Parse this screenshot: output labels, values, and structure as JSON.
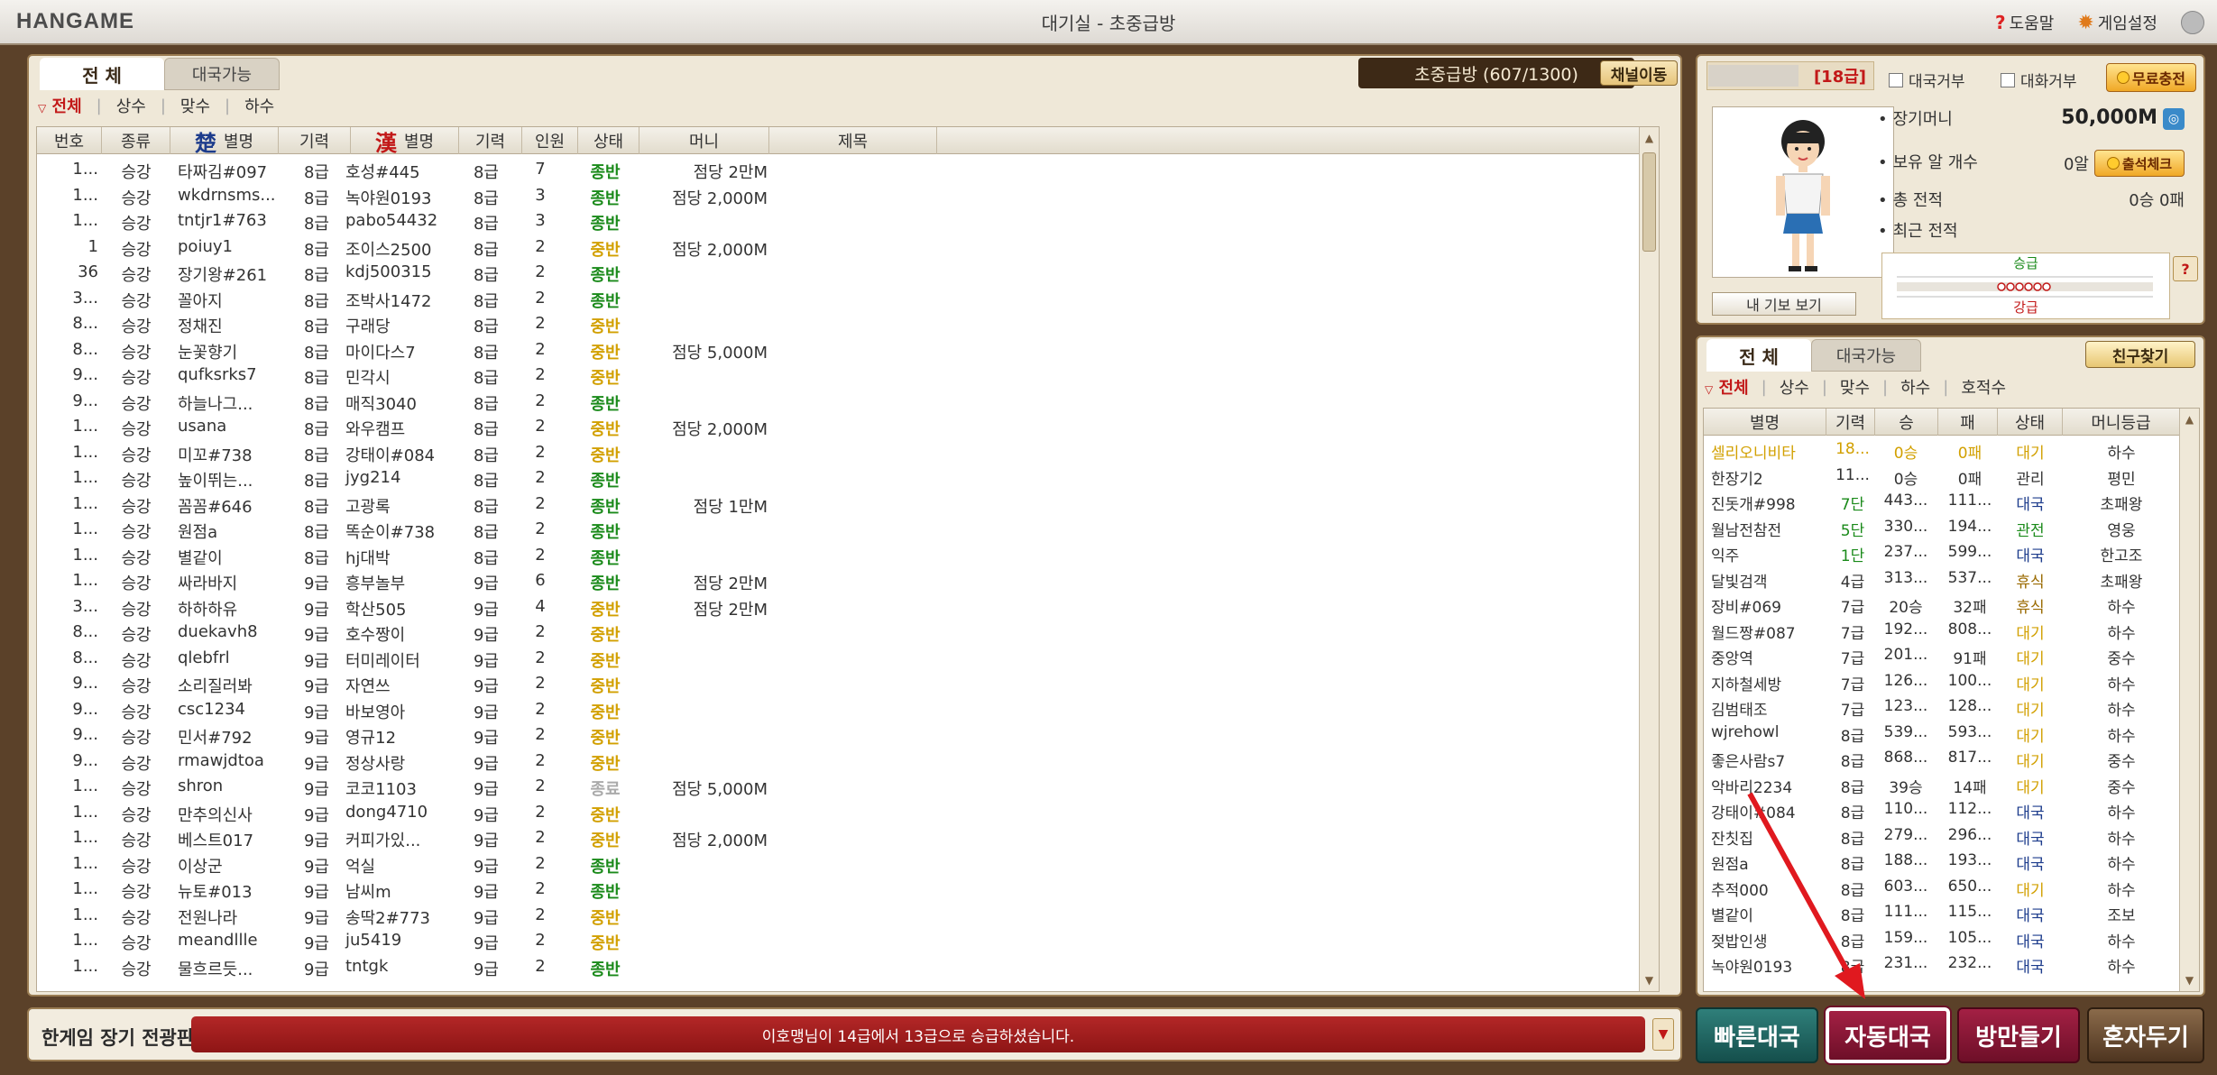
{
  "titlebar": {
    "logo": "HANGAME",
    "title": "대기실 - 초중급방",
    "help": "도움말",
    "settings": "게임설정"
  },
  "room_list": {
    "tabs": [
      "전 체",
      "대국가능"
    ],
    "room_name": "초중급방 (607/1300)",
    "channel_button": "채널이동",
    "filters": [
      "전체",
      "상수",
      "맞수",
      "하수"
    ],
    "columns": {
      "no": "번호",
      "kind": "종류",
      "chu_symbol": "楚",
      "name1": "별명",
      "level1": "기력",
      "han_symbol": "漢",
      "name2": "별명",
      "level2": "기력",
      "count": "인원",
      "status": "상태",
      "money": "머니",
      "title": "제목"
    },
    "rows": [
      [
        "1...",
        "승강",
        "타짜김#097",
        "8급",
        "호성#445",
        "8급",
        "7",
        "종반",
        "점당 2만M"
      ],
      [
        "1...",
        "승강",
        "wkdrnsms...",
        "8급",
        "녹야원0193",
        "8급",
        "3",
        "종반",
        "점당 2,000M"
      ],
      [
        "1...",
        "승강",
        "tntjr1#763",
        "8급",
        "pabo54432",
        "8급",
        "3",
        "종반",
        ""
      ],
      [
        "1",
        "승강",
        "poiuy1",
        "8급",
        "조이스2500",
        "8급",
        "2",
        "중반",
        "점당 2,000M"
      ],
      [
        "36",
        "승강",
        "장기왕#261",
        "8급",
        "kdj500315",
        "8급",
        "2",
        "종반",
        ""
      ],
      [
        "3...",
        "승강",
        "꼴아지",
        "8급",
        "조박사1472",
        "8급",
        "2",
        "종반",
        ""
      ],
      [
        "8...",
        "승강",
        "정채진",
        "8급",
        "구래당",
        "8급",
        "2",
        "중반",
        ""
      ],
      [
        "8...",
        "승강",
        "눈꽃향기",
        "8급",
        "마이다스7",
        "8급",
        "2",
        "중반",
        "점당 5,000M"
      ],
      [
        "9...",
        "승강",
        "qufksrks7",
        "8급",
        "민각시",
        "8급",
        "2",
        "중반",
        ""
      ],
      [
        "9...",
        "승강",
        "하늘나그...",
        "8급",
        "매직3040",
        "8급",
        "2",
        "종반",
        ""
      ],
      [
        "1...",
        "승강",
        "usana",
        "8급",
        "와우캠프",
        "8급",
        "2",
        "중반",
        "점당 2,000M"
      ],
      [
        "1...",
        "승강",
        "미꼬#738",
        "8급",
        "강태이#084",
        "8급",
        "2",
        "중반",
        ""
      ],
      [
        "1...",
        "승강",
        "높이뛰는...",
        "8급",
        "jyg214",
        "8급",
        "2",
        "종반",
        ""
      ],
      [
        "1...",
        "승강",
        "꼼꼼#646",
        "8급",
        "고광록",
        "8급",
        "2",
        "종반",
        "점당 1만M"
      ],
      [
        "1...",
        "승강",
        "원점a",
        "8급",
        "똑순이#738",
        "8급",
        "2",
        "종반",
        ""
      ],
      [
        "1...",
        "승강",
        "별같이",
        "8급",
        "hj대박",
        "8급",
        "2",
        "종반",
        ""
      ],
      [
        "1...",
        "승강",
        "싸라바지",
        "9급",
        "흥부놀부",
        "9급",
        "6",
        "종반",
        "점당 2만M"
      ],
      [
        "3...",
        "승강",
        "하하하유",
        "9급",
        "학산505",
        "9급",
        "4",
        "중반",
        "점당 2만M"
      ],
      [
        "8...",
        "승강",
        "duekavh8",
        "9급",
        "호수짱이",
        "9급",
        "2",
        "중반",
        ""
      ],
      [
        "8...",
        "승강",
        "qlebfrl",
        "9급",
        "터미레이터",
        "9급",
        "2",
        "중반",
        ""
      ],
      [
        "9...",
        "승강",
        "소리질러봐",
        "9급",
        "자연쓰",
        "9급",
        "2",
        "중반",
        ""
      ],
      [
        "9...",
        "승강",
        "csc1234",
        "9급",
        "바보영아",
        "9급",
        "2",
        "중반",
        ""
      ],
      [
        "9...",
        "승강",
        "민서#792",
        "9급",
        "영규12",
        "9급",
        "2",
        "중반",
        ""
      ],
      [
        "9...",
        "승강",
        "rmawjdtoa",
        "9급",
        "정상사랑",
        "9급",
        "2",
        "중반",
        ""
      ],
      [
        "1...",
        "승강",
        "shron",
        "9급",
        "코코1103",
        "9급",
        "2",
        "종료",
        "점당 5,000M"
      ],
      [
        "1...",
        "승강",
        "만추의신사",
        "9급",
        "dong4710",
        "9급",
        "2",
        "중반",
        ""
      ],
      [
        "1...",
        "승강",
        "베스트017",
        "9급",
        "커피가있...",
        "9급",
        "2",
        "중반",
        "점당 2,000M"
      ],
      [
        "1...",
        "승강",
        "이상군",
        "9급",
        "억실",
        "9급",
        "2",
        "종반",
        ""
      ],
      [
        "1...",
        "승강",
        "뉴토#013",
        "9급",
        "남씨m",
        "9급",
        "2",
        "종반",
        ""
      ],
      [
        "1...",
        "승강",
        "전원나라",
        "9급",
        "송딱2#773",
        "9급",
        "2",
        "중반",
        ""
      ],
      [
        "1...",
        "승강",
        "meandllle",
        "9급",
        "ju5419",
        "9급",
        "2",
        "중반",
        ""
      ],
      [
        "1...",
        "승강",
        "물흐르듯...",
        "9급",
        "tntgk",
        "9급",
        "2",
        "종반",
        ""
      ]
    ]
  },
  "news": {
    "title": "한게임 장기 전광판",
    "message": "이호맹님이 14급에서 13급으로 승급하셨습니다."
  },
  "profile": {
    "level": "[18급]",
    "refuse_game": "대국거부",
    "refuse_chat": "대화거부",
    "free_charge": "무료충전",
    "money_label": "장기머니",
    "money_value": "50,000M",
    "eggs_label": "보유 알 개수",
    "eggs_value": "0알",
    "attend_button": "출석체크",
    "total_label": "총 전적",
    "total_value": "0승 0패",
    "recent_label": "최근 전적",
    "graph_up": "승급",
    "graph_down": "강급",
    "my_info_button": "내 기보 보기",
    "help_icon": "?"
  },
  "friends": {
    "tabs": [
      "전 체",
      "대국가능"
    ],
    "find_button": "친구찾기",
    "filters": [
      "전체",
      "상수",
      "맞수",
      "하수",
      "호적수"
    ],
    "columns": {
      "name": "별명",
      "level": "기력",
      "win": "승",
      "loss": "패",
      "status": "상태",
      "grade": "머니등급"
    },
    "rows": [
      [
        "셀리오니비타",
        "18...",
        "0승",
        "0패",
        "대기",
        "하수"
      ],
      [
        "한장기2",
        "11...",
        "0승",
        "0패",
        "관리",
        "평민"
      ],
      [
        "진돗개#998",
        "7단",
        "443...",
        "111...",
        "대국",
        "초패왕"
      ],
      [
        "월남전참전",
        "5단",
        "330...",
        "194...",
        "관전",
        "영웅"
      ],
      [
        "익주",
        "1단",
        "237...",
        "599...",
        "대국",
        "한고조"
      ],
      [
        "달빛검객",
        "4급",
        "313...",
        "537...",
        "휴식",
        "초패왕"
      ],
      [
        "장비#069",
        "7급",
        "20승",
        "32패",
        "휴식",
        "하수"
      ],
      [
        "월드짱#087",
        "7급",
        "192...",
        "808...",
        "대기",
        "하수"
      ],
      [
        "중앙역",
        "7급",
        "201...",
        "91패",
        "대기",
        "중수"
      ],
      [
        "지하철세방",
        "7급",
        "126...",
        "100...",
        "대기",
        "하수"
      ],
      [
        "김범태조",
        "7급",
        "123...",
        "128...",
        "대기",
        "하수"
      ],
      [
        "wjrehowl",
        "8급",
        "539...",
        "593...",
        "대기",
        "하수"
      ],
      [
        "좋은사람s7",
        "8급",
        "868...",
        "817...",
        "대기",
        "중수"
      ],
      [
        "악바리2234",
        "8급",
        "39승",
        "14패",
        "대기",
        "중수"
      ],
      [
        "강태이#084",
        "8급",
        "110...",
        "112...",
        "대국",
        "하수"
      ],
      [
        "잔칫집",
        "8급",
        "279...",
        "296...",
        "대국",
        "하수"
      ],
      [
        "원점a",
        "8급",
        "188...",
        "193...",
        "대국",
        "하수"
      ],
      [
        "추적000",
        "8급",
        "603...",
        "650...",
        "대기",
        "하수"
      ],
      [
        "별같이",
        "8급",
        "111...",
        "115...",
        "대국",
        "조보"
      ],
      [
        "젖밥인생",
        "8급",
        "159...",
        "105...",
        "대국",
        "하수"
      ],
      [
        "녹야원0193",
        "8급",
        "231...",
        "232...",
        "대국",
        "하수"
      ]
    ]
  },
  "actions": {
    "quick": "빠른대국",
    "auto": "자동대국",
    "make_room": "방만들기",
    "solo": "혼자두기"
  },
  "colors": {
    "frame_brown": "#5b4129",
    "panel_bg": "#efe8d8",
    "status_late": "#1a8a1a",
    "status_mid": "#d2a000",
    "accent_red": "#c21818",
    "auto_button": "#a32044",
    "quick_button": "#2f7f7a",
    "annotation_arrow": "#e0191f"
  }
}
